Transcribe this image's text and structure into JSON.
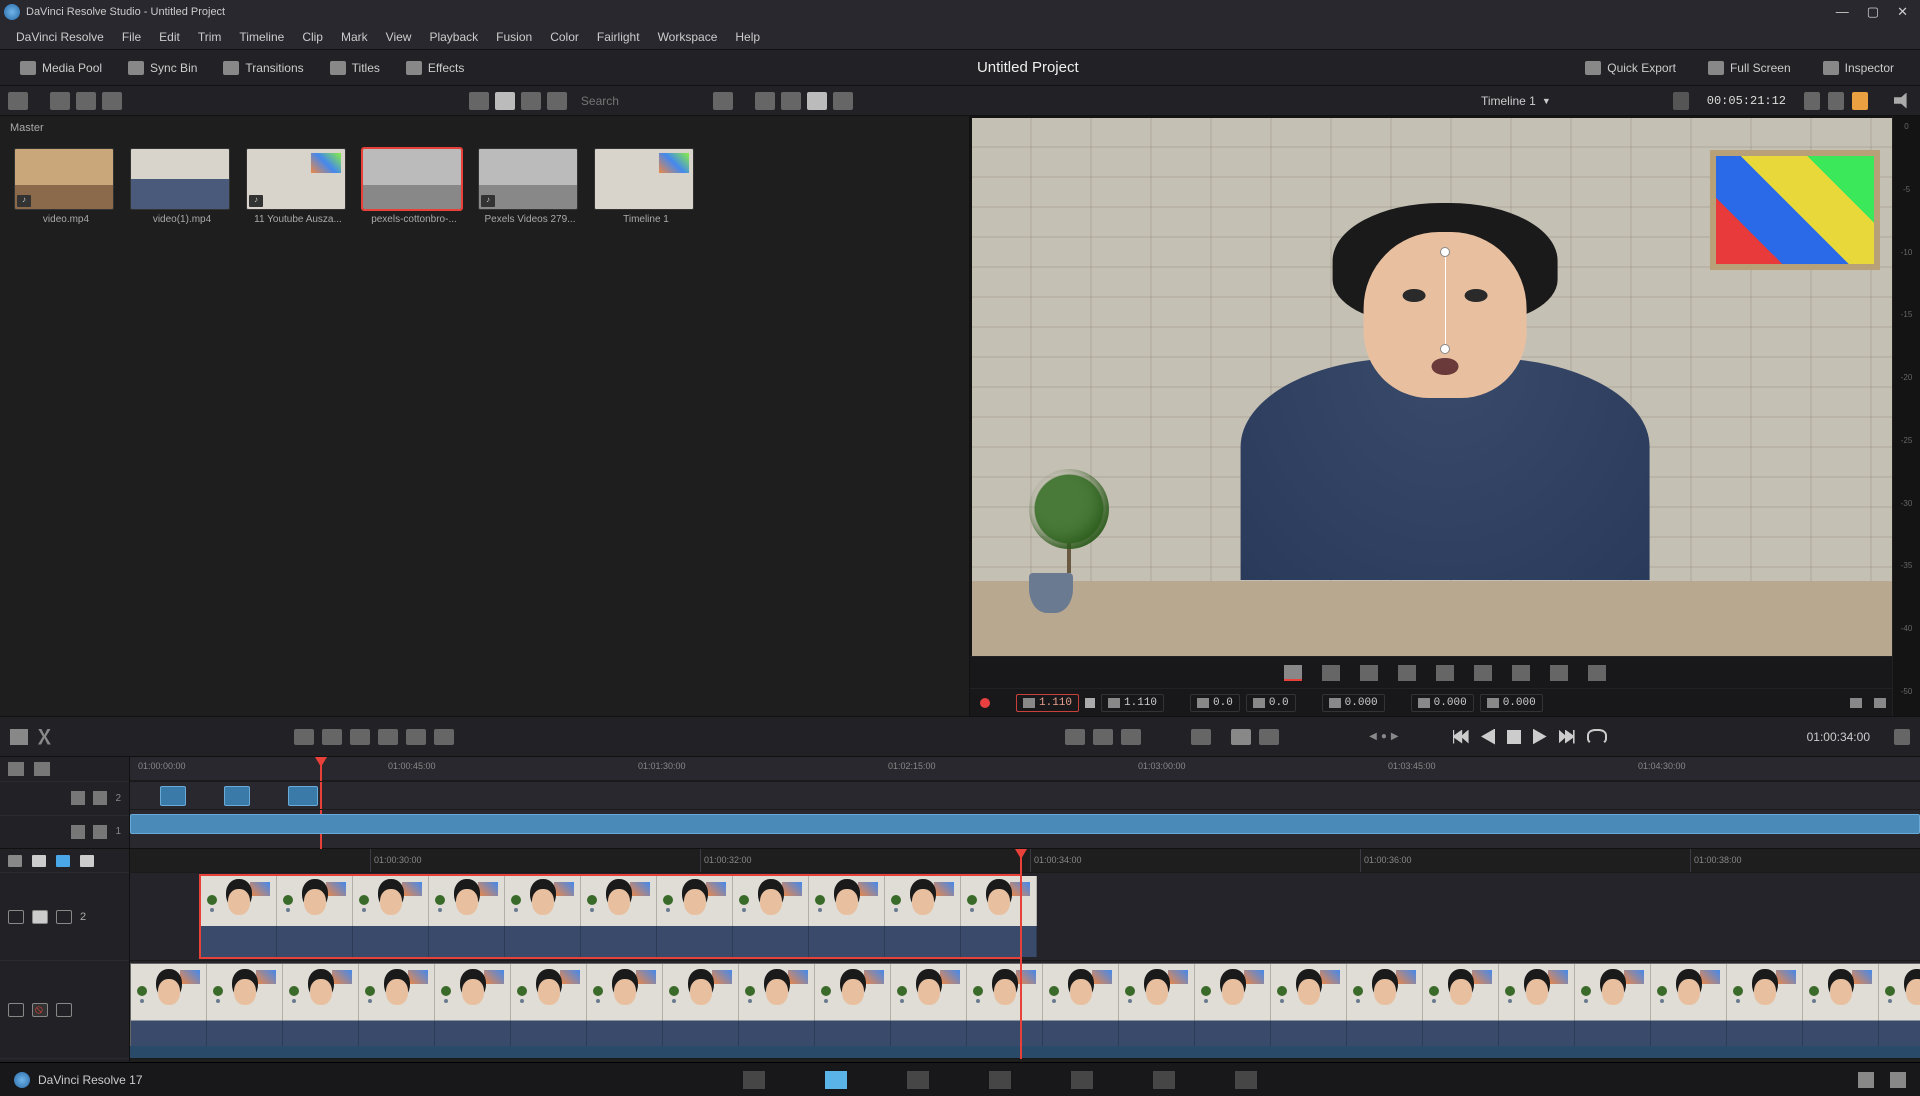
{
  "window": {
    "title": "DaVinci Resolve Studio - Untitled Project"
  },
  "menus": [
    "DaVinci Resolve",
    "File",
    "Edit",
    "Trim",
    "Timeline",
    "Clip",
    "Mark",
    "View",
    "Playback",
    "Fusion",
    "Color",
    "Fairlight",
    "Workspace",
    "Help"
  ],
  "toolbar": {
    "media_pool": "Media Pool",
    "sync_bin": "Sync Bin",
    "transitions": "Transitions",
    "titles": "Titles",
    "effects": "Effects",
    "project_title": "Untitled Project",
    "quick_export": "Quick Export",
    "full_screen": "Full Screen",
    "inspector": "Inspector"
  },
  "secbar": {
    "search_placeholder": "Search",
    "timeline_name": "Timeline 1",
    "viewer_tc": "00:05:21:12"
  },
  "media": {
    "bin": "Master",
    "clips": [
      {
        "label": "video.mp4",
        "kind": "beach",
        "audio": true
      },
      {
        "label": "video(1).mp4",
        "kind": "person",
        "audio": false
      },
      {
        "label": "11 Youtube Ausza...",
        "kind": "small-art",
        "audio": true
      },
      {
        "label": "pexels-cottonbro-...",
        "kind": "sport",
        "audio": false,
        "selected": true
      },
      {
        "label": "Pexels Videos 279...",
        "kind": "sport",
        "audio": true
      },
      {
        "label": "Timeline 1",
        "kind": "small-art",
        "audio": false
      }
    ]
  },
  "audio_meter_ticks": [
    "0",
    "-5",
    "-10",
    "-15",
    "-20",
    "-25",
    "-30",
    "-35",
    "-40",
    "-50"
  ],
  "xform": {
    "zoom_x": "1.110",
    "zoom_y": "1.110",
    "pos_x": "0.0",
    "pos_y": "0.0",
    "rot": "0.000",
    "anchor_x": "0.000",
    "anchor_y": "0.000"
  },
  "transport": {
    "record_tc": "01:00:34:00"
  },
  "upper_ruler": [
    "01:00:00:00",
    "01:00:45:00",
    "01:01:30:00",
    "01:02:15:00",
    "01:03:00:00",
    "01:03:45:00",
    "01:04:30:00"
  ],
  "upper_tracks": {
    "v2": "2",
    "v1": "1"
  },
  "lower_ruler": [
    "01:00:30:00",
    "01:00:32:00",
    "01:00:34:00",
    "01:00:36:00",
    "01:00:38:00"
  ],
  "lower_tracks": {
    "v2": "2"
  },
  "footer": {
    "app": "DaVinci Resolve 17"
  }
}
